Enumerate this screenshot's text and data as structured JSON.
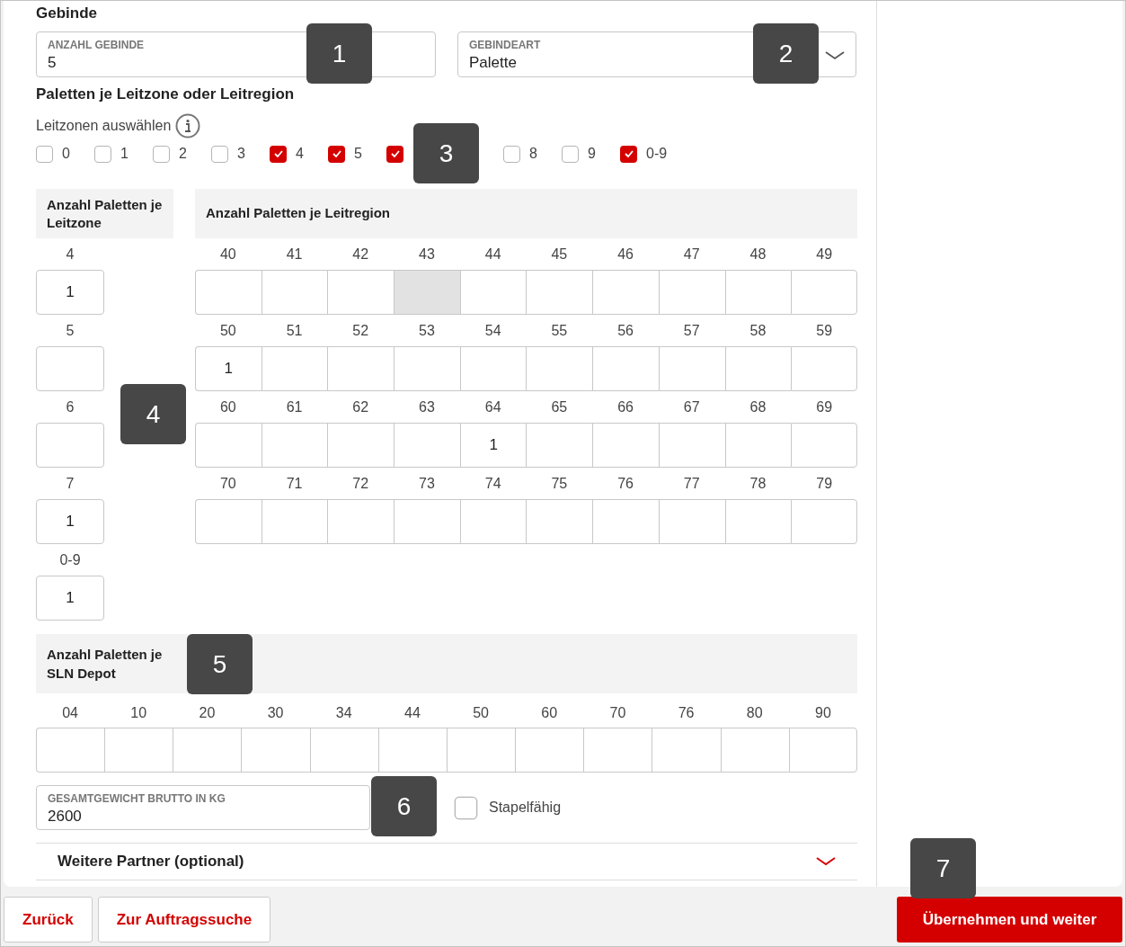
{
  "section_title": "Gebinde",
  "fields": {
    "count": {
      "label": "ANZAHL GEBINDE",
      "value": "5"
    },
    "type": {
      "label": "GEBINDEART",
      "value": "Palette"
    }
  },
  "zones_title": "Paletten je Leitzone oder Leitregion",
  "zone_select_label": "Leitzonen auswählen",
  "zone_checkboxes": [
    {
      "kind": "checkbox",
      "label": "0",
      "checked": false
    },
    {
      "kind": "checkbox",
      "label": "1",
      "checked": false
    },
    {
      "kind": "checkbox",
      "label": "2",
      "checked": false
    },
    {
      "kind": "checkbox",
      "label": "3",
      "checked": false
    },
    {
      "kind": "checkbox",
      "label": "4",
      "checked": true
    },
    {
      "kind": "checkbox",
      "label": "5",
      "checked": true
    },
    {
      "kind": "box_only",
      "checked": true
    },
    {
      "kind": "covered"
    },
    {
      "kind": "checkbox",
      "label": "8",
      "checked": false
    },
    {
      "kind": "checkbox",
      "label": "9",
      "checked": false
    },
    {
      "kind": "checkbox",
      "label": "0-9",
      "checked": true
    }
  ],
  "zone_table": {
    "zone_header": "Anzahl Paletten je Leitzone",
    "region_header": "Anzahl Paletten je Leitregion",
    "rows": [
      {
        "zone": "4",
        "value": "1",
        "regions": [
          {
            "label": "40",
            "disabled": false
          },
          {
            "label": "41",
            "disabled": false
          },
          {
            "label": "42",
            "disabled": false
          },
          {
            "label": "43",
            "disabled": true
          },
          {
            "label": "44",
            "disabled": false
          },
          {
            "label": "45",
            "disabled": false
          },
          {
            "label": "46",
            "disabled": false
          },
          {
            "label": "47",
            "disabled": false
          },
          {
            "label": "48",
            "disabled": false
          },
          {
            "label": "49",
            "disabled": false
          }
        ]
      },
      {
        "zone": "5",
        "regions": [
          {
            "label": "50",
            "value": "1",
            "disabled": false
          },
          {
            "label": "51",
            "disabled": false
          },
          {
            "label": "52",
            "disabled": false
          },
          {
            "label": "53",
            "disabled": false
          },
          {
            "label": "54",
            "disabled": false
          },
          {
            "label": "55",
            "disabled": false
          },
          {
            "label": "56",
            "disabled": false
          },
          {
            "label": "57",
            "disabled": false
          },
          {
            "label": "58",
            "disabled": false
          },
          {
            "label": "59",
            "disabled": false
          }
        ]
      },
      {
        "zone": "6",
        "regions": [
          {
            "label": "60",
            "disabled": false
          },
          {
            "label": "61",
            "disabled": false
          },
          {
            "label": "62",
            "disabled": false
          },
          {
            "label": "63",
            "disabled": false
          },
          {
            "label": "64",
            "value": "1",
            "disabled": false
          },
          {
            "label": "65",
            "disabled": false
          },
          {
            "label": "66",
            "disabled": false
          },
          {
            "label": "67",
            "disabled": false
          },
          {
            "label": "68",
            "disabled": false
          },
          {
            "label": "69",
            "disabled": false
          }
        ]
      },
      {
        "zone": "7",
        "value": "1",
        "regions": [
          {
            "label": "70",
            "disabled": false
          },
          {
            "label": "71",
            "disabled": false
          },
          {
            "label": "72",
            "disabled": false
          },
          {
            "label": "73",
            "disabled": false
          },
          {
            "label": "74",
            "disabled": false
          },
          {
            "label": "75",
            "disabled": false
          },
          {
            "label": "76",
            "disabled": false
          },
          {
            "label": "77",
            "disabled": false
          },
          {
            "label": "78",
            "disabled": false
          },
          {
            "label": "79",
            "disabled": false
          }
        ]
      },
      {
        "zone": "0-9",
        "value": "1"
      }
    ]
  },
  "depot_table": {
    "header": "Anzahl Paletten je SLN Depot",
    "columns": [
      {
        "label": "04"
      },
      {
        "label": "10"
      },
      {
        "label": "20"
      },
      {
        "label": "30"
      },
      {
        "label": "34"
      },
      {
        "label": "44"
      },
      {
        "label": "50"
      },
      {
        "label": "60"
      },
      {
        "label": "70"
      },
      {
        "label": "76"
      },
      {
        "label": "80"
      },
      {
        "label": "90"
      }
    ]
  },
  "weight": {
    "label": "GESAMTGEWICHT BRUTTO IN KG",
    "value": "2600"
  },
  "stackable": {
    "label": "Stapelfähig",
    "checked": false
  },
  "accordion": {
    "title": "Weitere Partner (optional)",
    "expanded": false
  },
  "buttons": [
    {
      "label": "Zurück",
      "kind": "secondary"
    },
    {
      "label": "Zur Auftragssuche",
      "kind": "secondary"
    },
    {
      "label": "Übernehmen und weiter",
      "kind": "primary"
    }
  ],
  "callouts": [
    "1",
    "2",
    "3",
    "4",
    "5",
    "6",
    "7"
  ]
}
